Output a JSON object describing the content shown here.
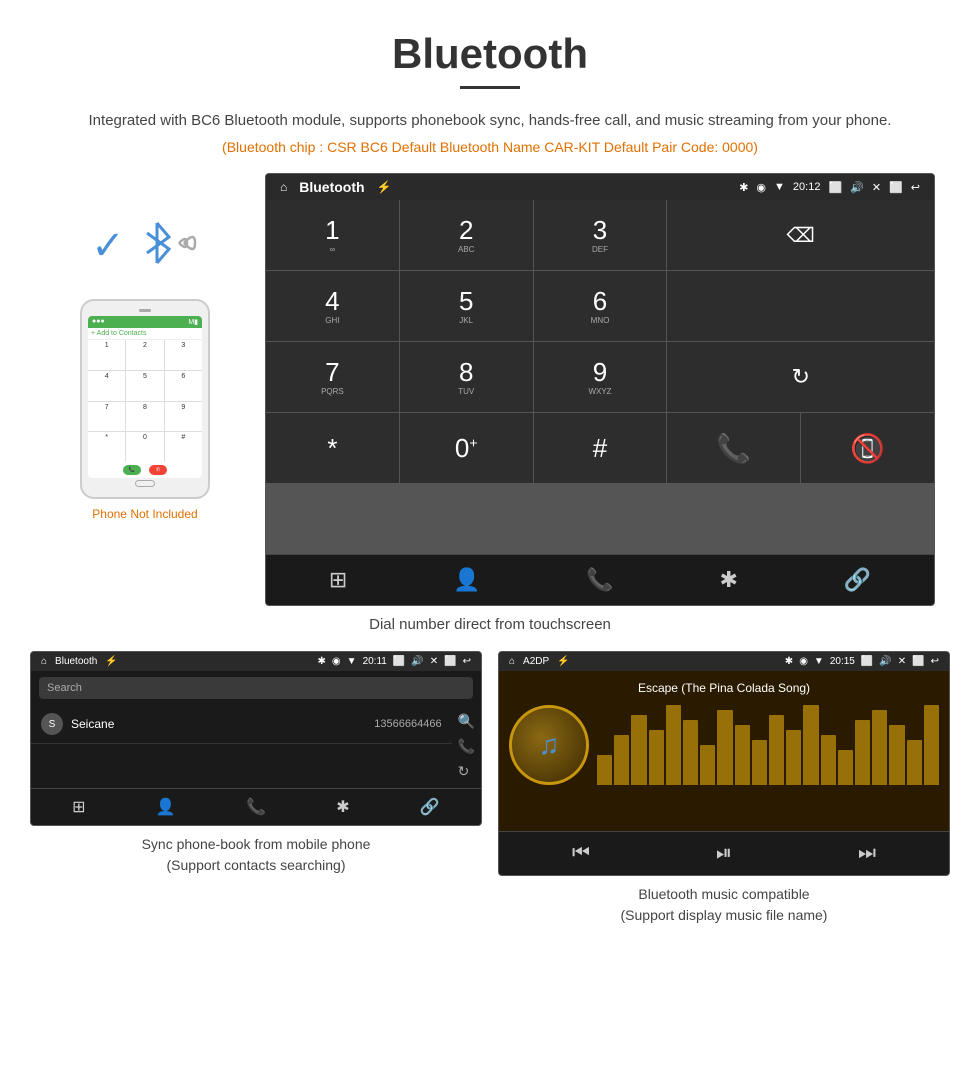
{
  "title": "Bluetooth",
  "description": "Integrated with BC6 Bluetooth module, supports phonebook sync, hands-free call, and music streaming from your phone.",
  "specs": "(Bluetooth chip : CSR BC6    Default Bluetooth Name CAR-KIT    Default Pair Code: 0000)",
  "main_caption": "Dial number direct from touchscreen",
  "phone_not_included": "Phone Not Included",
  "header": {
    "title": "Bluetooth",
    "time": "20:12",
    "usb_icon": "⚡",
    "home_icon": "⌂"
  },
  "dialpad": {
    "keys": [
      {
        "num": "1",
        "sub": "∞"
      },
      {
        "num": "2",
        "sub": "ABC"
      },
      {
        "num": "3",
        "sub": "DEF"
      },
      {
        "num": "4",
        "sub": "GHI"
      },
      {
        "num": "5",
        "sub": "JKL"
      },
      {
        "num": "6",
        "sub": "MNO"
      },
      {
        "num": "7",
        "sub": "PQRS"
      },
      {
        "num": "8",
        "sub": "TUV"
      },
      {
        "num": "9",
        "sub": "WXYZ"
      },
      {
        "num": "*",
        "sub": ""
      },
      {
        "num": "0",
        "sub": "+"
      },
      {
        "num": "#",
        "sub": ""
      }
    ]
  },
  "phonebook": {
    "status_title": "Bluetooth",
    "status_time": "20:11",
    "search_placeholder": "Search",
    "contacts": [
      {
        "initial": "S",
        "name": "Seicane",
        "number": "13566664466"
      }
    ],
    "caption": "Sync phone-book from mobile phone\n(Support contacts searching)"
  },
  "music": {
    "status_title": "A2DP",
    "status_time": "20:15",
    "track_name": "Escape (The Pina Colada Song)",
    "viz_heights": [
      30,
      50,
      70,
      55,
      80,
      65,
      40,
      75,
      60,
      45,
      70,
      55,
      80,
      50,
      35,
      65,
      75,
      60,
      45,
      80
    ],
    "caption": "Bluetooth music compatible\n(Support display music file name)"
  },
  "bottom_nav_icons": [
    "⋮⋮⋮",
    "👤",
    "📞",
    "✱",
    "🔗"
  ],
  "pb_nav_icons": [
    "⋮⋮⋮",
    "👤",
    "📞",
    "✱",
    "🔗"
  ]
}
